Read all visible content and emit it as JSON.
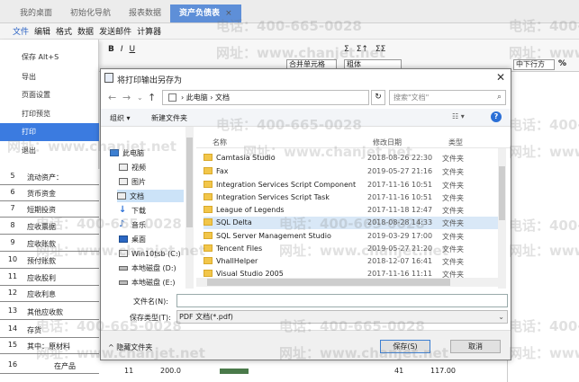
{
  "tabs": [
    {
      "label": "我的桌面"
    },
    {
      "label": "初始化导航"
    },
    {
      "label": "报表数据"
    },
    {
      "label": "资产负债表",
      "close": "×"
    }
  ],
  "menubar": [
    "文件",
    "编辑",
    "格式",
    "数据",
    "发送邮件",
    "计算器"
  ],
  "toolbar": {
    "row1": [
      "B",
      "I",
      "U",
      "合并单元格",
      "粗体",
      "中下行方",
      "%"
    ],
    "row2": [
      "Σ",
      "Σ↑",
      "ΣΣ"
    ]
  },
  "file_menu": [
    {
      "label": "保存 Alt+S"
    },
    {
      "label": "导出"
    },
    {
      "label": "页面设置"
    },
    {
      "label": "打印预览"
    },
    {
      "label": "打印"
    },
    {
      "label": "退出"
    }
  ],
  "sheet_rows": [
    {
      "num": "5",
      "text": "流动资产："
    },
    {
      "num": "6",
      "text": "货币资金"
    },
    {
      "num": "7",
      "text": "短期投资"
    },
    {
      "num": "8",
      "text": "应收票据"
    },
    {
      "num": "9",
      "text": "应收账款"
    },
    {
      "num": "10",
      "text": "预付账款"
    },
    {
      "num": "11",
      "text": "应收股利"
    },
    {
      "num": "12",
      "text": "应收利息"
    },
    {
      "num": "13",
      "text": "其他应收款"
    },
    {
      "num": "14",
      "text": "存货"
    },
    {
      "num": "15",
      "text": "其中：原材料"
    },
    {
      "num": "16",
      "text": "在产品"
    }
  ],
  "bottom_values": {
    "c1": "11",
    "c2": "200.0",
    "c3": "41",
    "c4": "117.00"
  },
  "dialog": {
    "title": "将打印输出另存为",
    "close": "✕",
    "breadcrumb": [
      "此电脑",
      "文档"
    ],
    "refresh": "↻",
    "search_placeholder": "搜索\"文档\"",
    "organize": "组织 ▾",
    "new_folder": "新建文件夹",
    "view": "☷ ▾",
    "help": "?",
    "nav_pane": [
      {
        "label": "此电脑",
        "icon": "computer-icon"
      },
      {
        "label": "视频",
        "icon": "video-icon"
      },
      {
        "label": "图片",
        "icon": "picture-icon"
      },
      {
        "label": "文档",
        "icon": "document-icon",
        "selected": true
      },
      {
        "label": "下载",
        "icon": "download-icon"
      },
      {
        "label": "音乐",
        "icon": "music-icon"
      },
      {
        "label": "桌面",
        "icon": "desktop-icon"
      },
      {
        "label": "Win10tsb (C:)",
        "icon": "drive-icon"
      },
      {
        "label": "本地磁盘 (D:)",
        "icon": "drive-icon"
      },
      {
        "label": "本地磁盘 (E:)",
        "icon": "drive-icon"
      }
    ],
    "columns": {
      "name": "名称",
      "date": "修改日期",
      "type": "类型"
    },
    "files": [
      {
        "name": "Camtasia Studio",
        "date": "2018-08-26 22:30",
        "type": "文件夹"
      },
      {
        "name": "Fax",
        "date": "2019-05-27 21:16",
        "type": "文件夹"
      },
      {
        "name": "Integration Services Script Component",
        "date": "2017-11-16 10:51",
        "type": "文件夹"
      },
      {
        "name": "Integration Services Script Task",
        "date": "2017-11-16 10:51",
        "type": "文件夹"
      },
      {
        "name": "League of Legends",
        "date": "2017-11-18 12:47",
        "type": "文件夹"
      },
      {
        "name": "SQL Delta",
        "date": "2018-08-28 14:33",
        "type": "文件夹",
        "selected": true
      },
      {
        "name": "SQL Server Management Studio",
        "date": "2019-03-29 17:00",
        "type": "文件夹"
      },
      {
        "name": "Tencent Files",
        "date": "2019-05-27 21:20",
        "type": "文件夹"
      },
      {
        "name": "VhallHelper",
        "date": "2018-12-07 16:41",
        "type": "文件夹"
      },
      {
        "name": "Visual Studio 2005",
        "date": "2017-11-16 11:11",
        "type": "文件夹"
      }
    ],
    "filename_label": "文件名(N):",
    "filename_value": "",
    "filetype_label": "保存类型(T):",
    "filetype_value": "PDF 文档(*.pdf)",
    "hide_folders": "^ 隐藏文件夹",
    "save": "保存(S)",
    "cancel": "取消"
  },
  "watermarks": [
    "电话：400-665-0028",
    "网址：www.chanjet.net"
  ]
}
